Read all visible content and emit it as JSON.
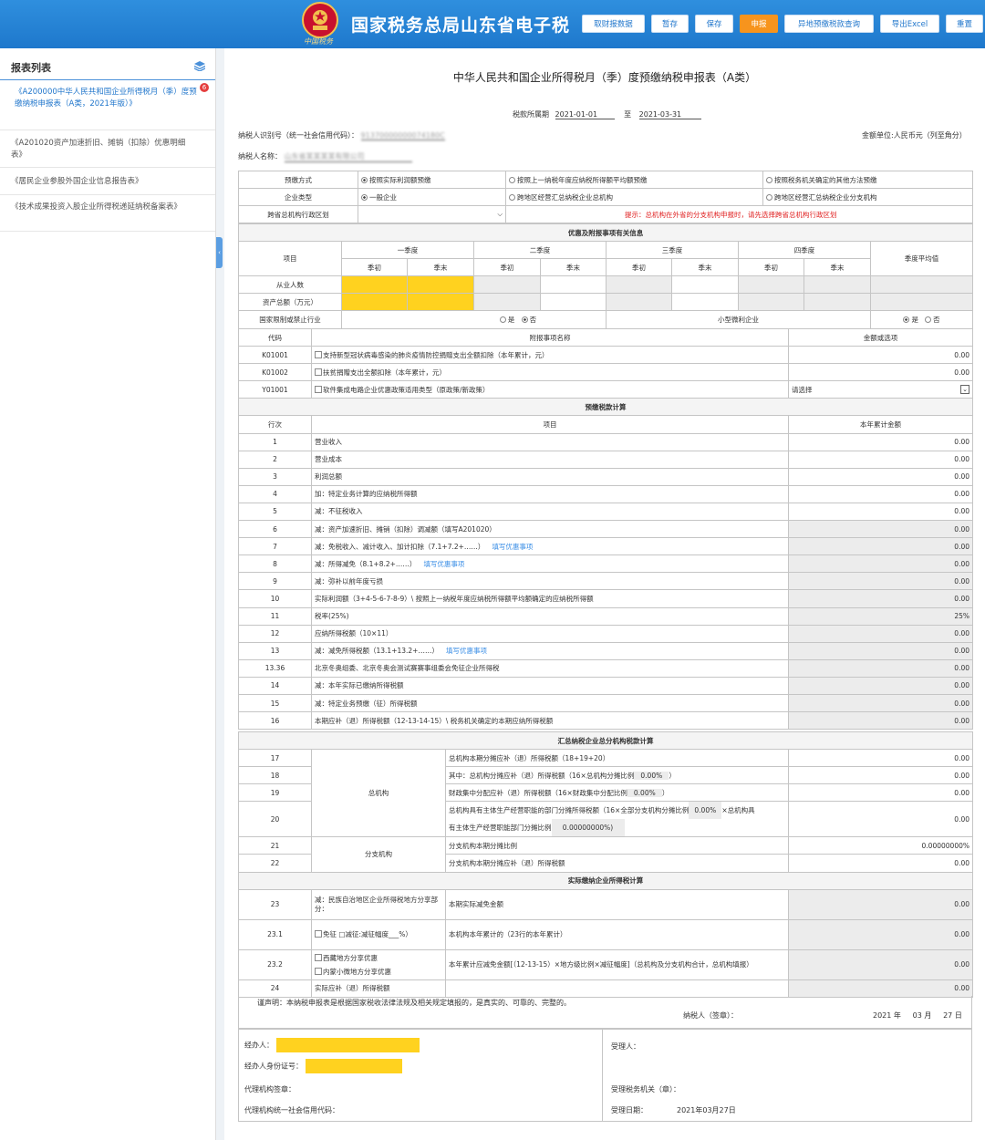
{
  "header": {
    "site_title": "国家税务总局山东省电子税",
    "motto": "中国税务",
    "buttons": [
      "取财报数据",
      "暂存",
      "保存",
      "申报",
      "异地预缴税款查询",
      "导出Excel",
      "重置"
    ]
  },
  "sidebar": {
    "title": "报表列表",
    "badge": "6",
    "items": [
      "《A200000中华人民共和国企业所得税月（季）度预缴纳税申报表（A类，2021年版）》",
      "《A201020资产加速折旧、摊销（扣除）优惠明细表》",
      "《居民企业参股外国企业信息报告表》",
      "《技术成果投资入股企业所得税递延纳税备案表》"
    ]
  },
  "form": {
    "title": "中华人民共和国企业所得税月（季）度预缴纳税申报表（A类）",
    "period_label": "税款所属期",
    "period_start": "2021-01-01",
    "period_to": "至",
    "period_end": "2021-03-31",
    "taxid_label": "纳税人识别号（统一社会信用代码）：",
    "taxid_value": "91370000000074180C",
    "unit": "金额单位:人民币元（列至角分）",
    "name_label": "纳税人名称：",
    "name_value": "山东省某某某某有限公司"
  },
  "method": {
    "label": "预缴方式",
    "opt1": "按照实际利润额预缴",
    "opt2": "按照上一纳税年度应纳税所得额平均额预缴",
    "opt3": "按照税务机关确定的其他方法预缴",
    "type_label": "企业类型",
    "t1": "一般企业",
    "t2": "跨地区经营汇总纳税企业总机构",
    "t3": "跨地区经营汇总纳税企业分支机构",
    "region_label": "跨省总机构行政区划",
    "hint": "提示：总机构在外省的分支机构申报时，请先选择跨省总机构行政区划"
  },
  "info": {
    "section": "优惠及附报事项有关信息",
    "item": "项目",
    "q1": "一季度",
    "q2": "二季度",
    "q3": "三季度",
    "q4": "四季度",
    "avg": "季度平均值",
    "begin": "季初",
    "end": "季末",
    "emp": "从业人数",
    "assets": "资产总额（万元）",
    "restricted": "国家限制或禁止行业",
    "yes": "是",
    "no": "否",
    "small": "小型微利企业"
  },
  "attach": {
    "code_h": "代码",
    "name_h": "附报事项名称",
    "amt_h": "金额或选项",
    "rows": [
      {
        "code": "K01001",
        "name": "支持新型冠状病毒感染的肺炎疫情防控捐赠支出全额扣除（本年累计，元）",
        "val": "0.00"
      },
      {
        "code": "K01002",
        "name": "扶贫捐赠支出全额扣除（本年累计，元）",
        "val": "0.00"
      },
      {
        "code": "Y01001",
        "name": "软件集成电路企业优惠政策适用类型（原政策/新政策）",
        "val": "请选择"
      }
    ]
  },
  "calc": {
    "section": "预缴税款计算",
    "line_h": "行次",
    "item_h": "项目",
    "amt_h": "本年累计金额",
    "link": "填写优惠事项",
    "rows": [
      {
        "no": "1",
        "name": "营业收入",
        "val": "0.00"
      },
      {
        "no": "2",
        "name": "营业成本",
        "val": "0.00"
      },
      {
        "no": "3",
        "name": "利润总额",
        "val": "0.00"
      },
      {
        "no": "4",
        "name": "加：特定业务计算的应纳税所得额",
        "val": "0.00"
      },
      {
        "no": "5",
        "name": "减：不征税收入",
        "val": "0.00"
      },
      {
        "no": "6",
        "name": "减：资产加速折旧、摊销（扣除）调减额（填写A201020）",
        "val": "0.00"
      },
      {
        "no": "7",
        "name": "减：免税收入、减计收入、加计扣除（7.1+7.2+……）",
        "val": "0.00"
      },
      {
        "no": "8",
        "name": "减：所得减免（8.1+8.2+……）",
        "val": "0.00"
      },
      {
        "no": "9",
        "name": "减：弥补以前年度亏损",
        "val": "0.00"
      },
      {
        "no": "10",
        "name": "实际利润额（3+4-5-6-7-8-9）\\ 按照上一纳税年度应纳税所得额平均额确定的应纳税所得额",
        "val": "0.00"
      },
      {
        "no": "11",
        "name": "税率(25%)",
        "val": "25%"
      },
      {
        "no": "12",
        "name": "应纳所得税额（10×11）",
        "val": "0.00"
      },
      {
        "no": "13",
        "name": "减：减免所得税额（13.1+13.2+……）",
        "val": "0.00"
      },
      {
        "no": "13.36",
        "name": "北京冬奥组委、北京冬奥会测试赛赛事组委会免征企业所得税",
        "val": "0.00"
      },
      {
        "no": "14",
        "name": "减：本年实际已缴纳所得税额",
        "val": "0.00"
      },
      {
        "no": "15",
        "name": "减：特定业务预缴（征）所得税额",
        "val": "0.00"
      },
      {
        "no": "16",
        "name": "本期应补（退）所得税额（12-13-14-15）\\ 税务机关确定的本期应纳所得税额",
        "val": "0.00"
      }
    ]
  },
  "summary": {
    "section": "汇总纳税企业总分机构税款计算",
    "hq": "总机构",
    "branch": "分支机构",
    "rows": [
      {
        "no": "17",
        "name": "总机构本期分摊应补（退）所得税额（18+19+20）",
        "val": "0.00"
      },
      {
        "no": "18",
        "name": "其中：总机构分摊应补（退）所得税额（16×总机构分摊比例",
        "pct": "0.00%",
        "tail": "）",
        "val": "0.00"
      },
      {
        "no": "19",
        "name": "财政集中分配应补（退）所得税额（16×财政集中分配比例",
        "pct": "0.00%",
        "tail": "）",
        "val": "0.00"
      },
      {
        "no": "20",
        "name": "总机构具有主体生产经营职能的部门分摊所得税额（16×全部分支机构分摊比例",
        "pct": "0.00%",
        "tail": "×总机构具",
        "name2": "有主体生产经营职能部门分摊比例",
        "pct2": "0.00000000%)",
        "val": "0.00"
      },
      {
        "no": "21",
        "name": "分支机构本期分摊比例",
        "val": "0.00000000%"
      },
      {
        "no": "22",
        "name": "分支机构本期分摊应补（退）所得税额",
        "val": "0.00"
      }
    ]
  },
  "actual": {
    "section": "实际缴纳企业所得税计算",
    "rows": [
      {
        "no": "23",
        "label": "减：民族自治地区企业所得税地方分享部分：",
        "name": "本期实际减免金额",
        "val": "0.00"
      },
      {
        "no": "23.1",
        "label": "免征 □减征:减征幅度___%）",
        "name": "本机构本年累计的（23行的本年累计）",
        "val": "0.00"
      },
      {
        "no": "23.2",
        "label1": "西藏地方分享优惠",
        "label2": "内蒙小微地方分享优惠",
        "name": "本年累计应减免金额[（12-13-15）×地方级比例×减征幅度]（总机构及分支机构合计，总机构填报）",
        "val": "0.00"
      },
      {
        "no": "24",
        "label": "实际应补（退）所得税额",
        "val": "0.00"
      }
    ]
  },
  "declaration": {
    "text": "谨声明：本纳税申报表是根据国家税收法律法规及相关规定填报的，是真实的、可靠的、完整的。",
    "signer": "纳税人（签章）：",
    "year": "2021",
    "y": "年",
    "month": "03",
    "m": "月",
    "day": "27",
    "d": "日"
  },
  "sign": {
    "agent": "经办人：",
    "agent_id": "经办人身份证号：",
    "org_seal": "代理机构签章：",
    "org_code": "代理机构统一社会信用代码：",
    "receiver": "受理人：",
    "office": "受理税务机关（章）：",
    "date_label": "受理日期：",
    "date_value": "2021年03月27日"
  }
}
